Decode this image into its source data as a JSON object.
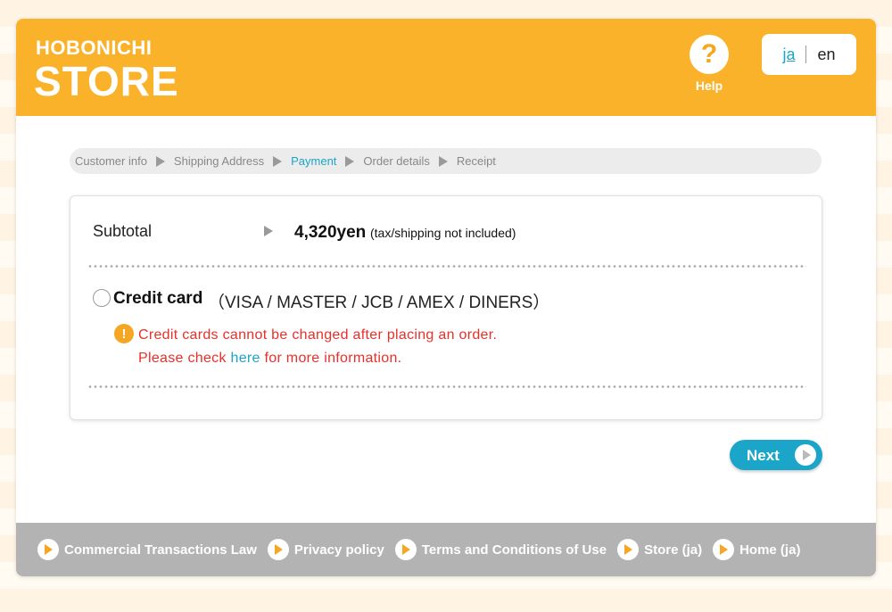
{
  "header": {
    "logo_top": "HOBONICHI",
    "logo_bottom": "STORE",
    "help_label": "Help",
    "lang_ja": "ja",
    "lang_en": "en",
    "brand_color": "#fbb22b"
  },
  "steps": [
    "Customer info",
    "Shipping Address",
    "Payment",
    "Order details",
    "Receipt"
  ],
  "active_step": "Payment",
  "panel": {
    "subtotal_label": "Subtotal",
    "subtotal_value": "4,320yen",
    "subtotal_note": "(tax/shipping not included)",
    "payment_option": "Credit card",
    "payment_brands": "（VISA / MASTER / JCB / AMEX / DINERS）",
    "warning_line1": "Credit cards cannot be changed after placing an order.",
    "warning_line2_pre": "Please check ",
    "warning_link": "here",
    "warning_line2_post": " for more information."
  },
  "next_label": "Next",
  "footer": {
    "links": [
      "Commercial Transactions Law",
      "Privacy policy",
      "Terms and Conditions of Use",
      "Store (ja)",
      "Home (ja)"
    ]
  },
  "colors": {
    "accent": "#1ba5c9",
    "warning": "#e8302a",
    "footer_bg": "#b3b3b3"
  }
}
